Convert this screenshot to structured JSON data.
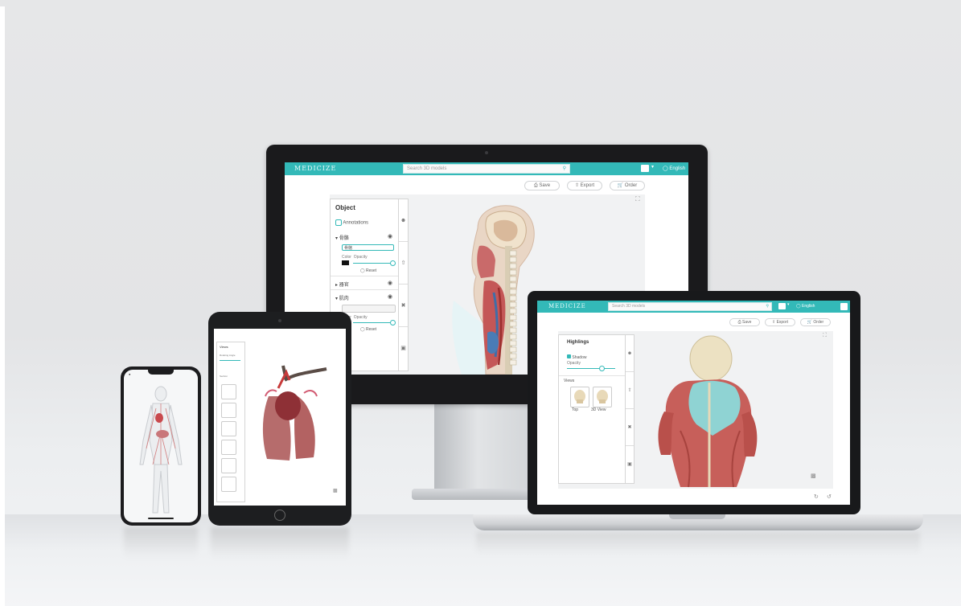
{
  "colors": {
    "accent": "#33b9b8",
    "screen_bg": "#ffffff",
    "viewport_bg": "#f1f2f3"
  },
  "desktop": {
    "brand": "MEDICIZE",
    "search_placeholder": "Search 3D models",
    "language": "English",
    "toolbar": {
      "save": "Save",
      "export": "Export",
      "order": "Order"
    },
    "panel": {
      "title": "Object",
      "annotations": "Annotations",
      "groups": [
        {
          "label": "骨骼",
          "expanded": true,
          "select_value": "骨骼",
          "color_label": "Color",
          "opacity_label": "Opacity",
          "reset": "Reset"
        },
        {
          "label": "器官",
          "expanded": false
        },
        {
          "label": "肌肉",
          "expanded": true,
          "select_value": "",
          "color_label": "Color",
          "opacity_label": "Opacity",
          "reset": "Reset"
        }
      ]
    },
    "icons": [
      "person-icon",
      "upload-icon",
      "x-ray-icon",
      "crop-icon"
    ]
  },
  "laptop": {
    "brand": "MEDICIZE",
    "search_placeholder": "Search 3D models",
    "language": "English",
    "toolbar": {
      "save": "Save",
      "export": "Export",
      "order": "Order"
    },
    "panel": {
      "title": "Highlings",
      "shadow_label": "Shadow",
      "opacity_label": "Opacity",
      "views_title": "Views",
      "views": [
        {
          "label": "Top"
        },
        {
          "label": "3D View"
        }
      ]
    }
  },
  "tablet": {
    "panel": {
      "title": "Views",
      "rotate_label": "Rotating Angle",
      "section_label": "Section"
    }
  }
}
